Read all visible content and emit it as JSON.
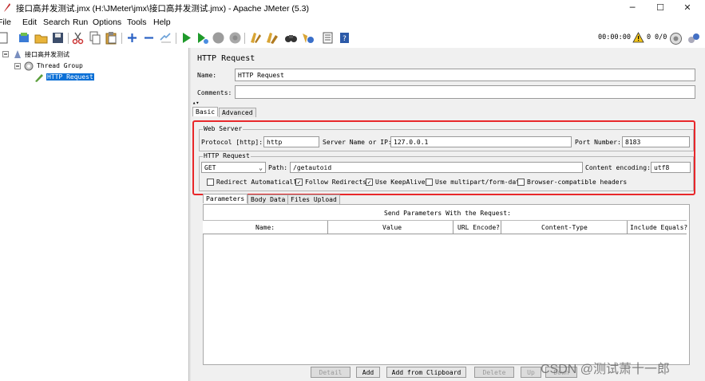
{
  "window": {
    "title": "接口高并发测试.jmx (H:\\JMeter\\jmx\\接口高并发测试.jmx) - Apache JMeter (5.3)",
    "minimize": "─",
    "maximize": "☐",
    "close": "✕"
  },
  "menu": [
    "File",
    "Edit",
    "Search",
    "Run",
    "Options",
    "Tools",
    "Help"
  ],
  "status": {
    "timer": "00:00:00",
    "errors": "0",
    "threads": "0/0"
  },
  "tree": {
    "root": "接口高并发测试",
    "thread_group": "Thread Group",
    "sampler": "HTTP Request"
  },
  "panel": {
    "title": "HTTP Request",
    "name_label": "Name:",
    "name_value": "HTTP Request",
    "comments_label": "Comments:",
    "comments_value": "",
    "tabs": [
      "Basic",
      "Advanced"
    ],
    "web_server": {
      "legend": "Web Server",
      "protocol_label": "Protocol [http]:",
      "protocol_value": "http",
      "server_label": "Server Name or IP:",
      "server_value": "127.0.0.1",
      "port_label": "Port Number:",
      "port_value": "8183"
    },
    "http_request": {
      "legend": "HTTP Request",
      "method": "GET",
      "path_label": "Path:",
      "path_value": "/getautoid",
      "encoding_label": "Content encoding:",
      "encoding_value": "utf8",
      "options": [
        {
          "label": "Redirect Automatically",
          "checked": false
        },
        {
          "label": "Follow Redirects",
          "checked": true
        },
        {
          "label": "Use KeepAlive",
          "checked": true
        },
        {
          "label": "Use multipart/form-data",
          "checked": false
        },
        {
          "label": "Browser-compatible headers",
          "checked": false
        }
      ]
    },
    "param_tabs": [
      "Parameters",
      "Body Data",
      "Files Upload"
    ],
    "params_caption": "Send Parameters With the Request:",
    "columns": [
      "Name:",
      "Value",
      "URL Encode?",
      "Content-Type",
      "Include Equals?"
    ],
    "buttons": [
      {
        "label": "Detail",
        "enabled": false
      },
      {
        "label": "Add",
        "enabled": true
      },
      {
        "label": "Add from Clipboard",
        "enabled": true
      },
      {
        "label": "Delete",
        "enabled": false
      },
      {
        "label": "Up",
        "enabled": false
      },
      {
        "label": "Down",
        "enabled": false
      }
    ]
  },
  "watermark": "CSDN @测试萧十一郎",
  "colors": {
    "highlight_border": "#e8272a",
    "selection": "#0a6fd6",
    "accent_green": "#1f9a2b"
  }
}
